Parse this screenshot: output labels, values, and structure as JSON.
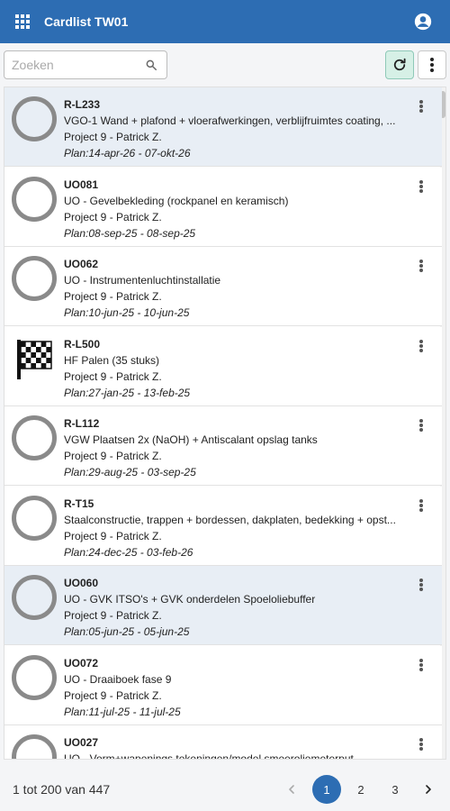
{
  "header": {
    "title": "Cardlist TW01"
  },
  "search": {
    "placeholder": "Zoeken",
    "value": ""
  },
  "cards": [
    {
      "code": "R-L233",
      "description": "VGO-1 Wand + plafond + vloerafwerkingen, verblijfruimtes coating, ...",
      "project": "Project 9 - Patrick Z.",
      "plan": "Plan:14-apr-26 - 07-okt-26",
      "status_icon": "circle-icon",
      "selected": true
    },
    {
      "code": "UO081",
      "description": "UO - Gevelbekleding (rockpanel en keramisch)",
      "project": "Project 9 - Patrick Z.",
      "plan": "Plan:08-sep-25 - 08-sep-25",
      "status_icon": "circle-icon",
      "selected": false
    },
    {
      "code": "UO062",
      "description": "UO - Instrumentenluchtinstallatie",
      "project": "Project 9 - Patrick Z.",
      "plan": "Plan:10-jun-25 - 10-jun-25",
      "status_icon": "circle-icon",
      "selected": false
    },
    {
      "code": "R-L500",
      "description": "HF Palen (35 stuks)",
      "project": "Project 9 - Patrick Z.",
      "plan": "Plan:27-jan-25 - 13-feb-25",
      "status_icon": "checkered-flag-icon",
      "selected": false
    },
    {
      "code": "R-L112",
      "description": "VGW Plaatsen 2x (NaOH) + Antiscalant opslag tanks",
      "project": "Project 9 - Patrick Z.",
      "plan": "Plan:29-aug-25 - 03-sep-25",
      "status_icon": "circle-icon",
      "selected": false
    },
    {
      "code": "R-T15",
      "description": "Staalconstructie, trappen + bordessen, dakplaten, bedekking + opst...",
      "project": "Project 9 - Patrick Z.",
      "plan": "Plan:24-dec-25 - 03-feb-26",
      "status_icon": "circle-icon",
      "selected": false
    },
    {
      "code": "UO060",
      "description": "UO - GVK ITSO's + GVK onderdelen Spoeloliebuffer",
      "project": "Project 9 - Patrick Z.",
      "plan": "Plan:05-jun-25 - 05-jun-25",
      "status_icon": "circle-icon",
      "selected": true
    },
    {
      "code": "UO072",
      "description": "UO - Draaiboek fase 9",
      "project": "Project 9 - Patrick Z.",
      "plan": "Plan:11-jul-25 - 11-jul-25",
      "status_icon": "circle-icon",
      "selected": false
    },
    {
      "code": "UO027",
      "description": "UO - Vorm+wapenings tekeningen/model smeeroliemeterput",
      "project": "",
      "plan": "",
      "status_icon": "circle-icon",
      "selected": false
    }
  ],
  "pagination": {
    "summary": "1 tot 200 van 447",
    "pages": [
      "1",
      "2",
      "3"
    ],
    "current_page": "1"
  },
  "colors": {
    "header_bg": "#2d6db3",
    "selected_row_bg": "#e8eef5",
    "refresh_btn_bg": "#d6f0e6",
    "status_circle": "#8a8a8a"
  }
}
